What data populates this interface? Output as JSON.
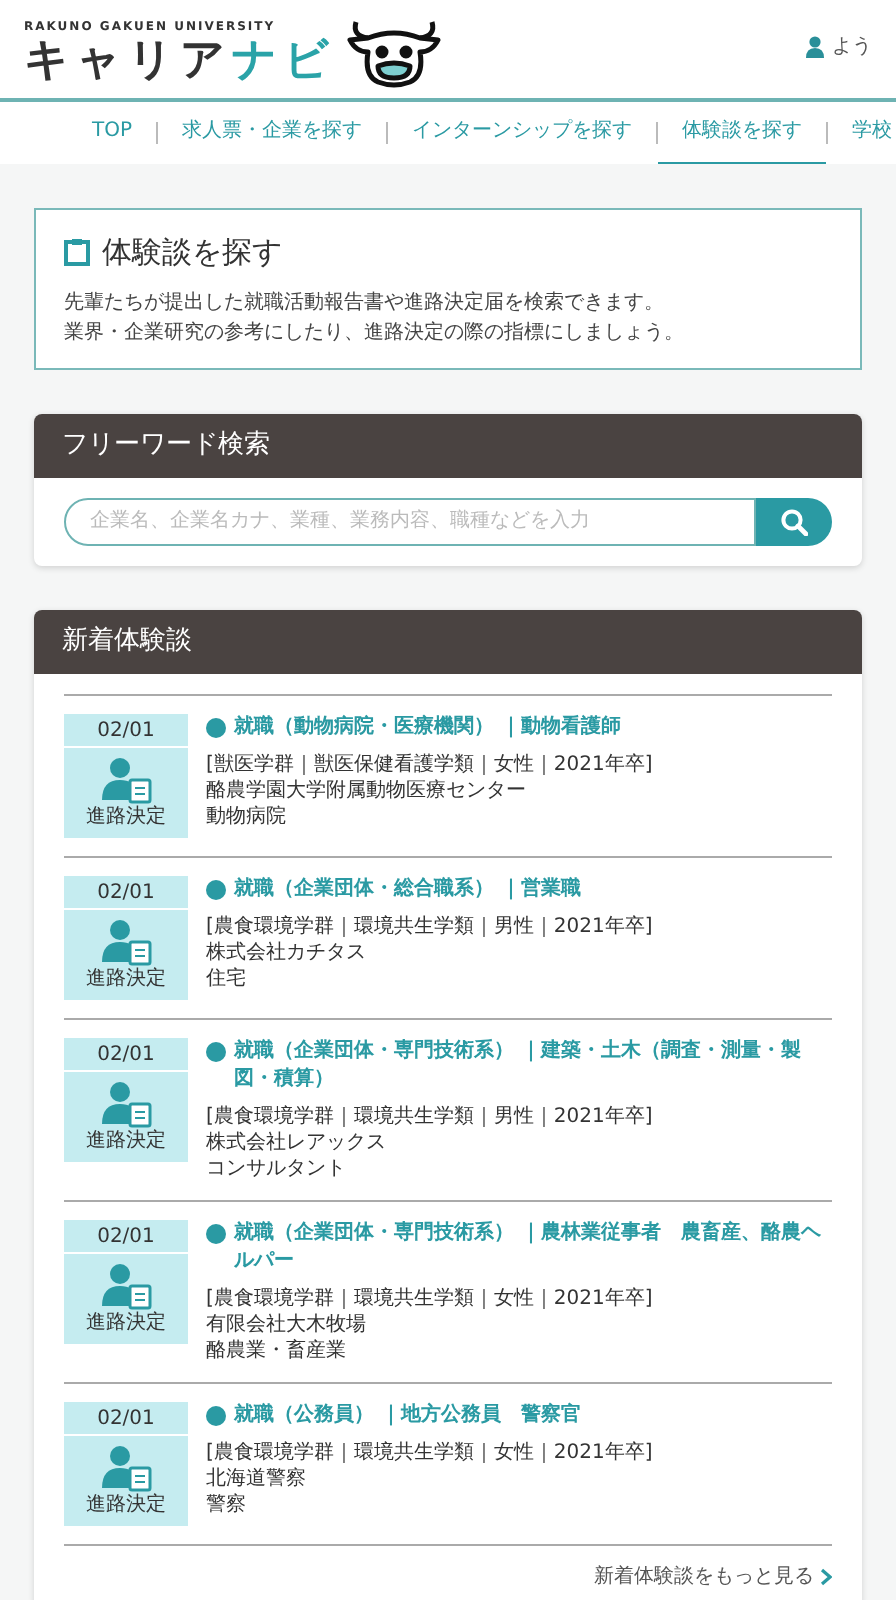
{
  "header": {
    "tagline": "RAKUNO GAKUEN UNIVERSITY",
    "logo_main": "キャリア",
    "logo_accent": "ナビ",
    "user_text": "よう"
  },
  "nav": [
    {
      "label": "TOP",
      "selected": false
    },
    {
      "label": "求人票・企業を探す",
      "selected": false
    },
    {
      "label": "インターンシップを探す",
      "selected": false
    },
    {
      "label": "体験談を探す",
      "selected": true
    },
    {
      "label": "学校",
      "selected": false
    }
  ],
  "intro": {
    "title": "体験談を探す",
    "lines": [
      "先輩たちが提出した就職活動報告書や進路決定届を検索できます。",
      "業界・企業研究の参考にしたり、進路決定の際の指標にしましょう。"
    ]
  },
  "search": {
    "title": "フリーワード検索",
    "placeholder": "企業名、企業名カナ、業種、業務内容、職種などを入力"
  },
  "news": {
    "title": "新着体験談",
    "more_link": "新着体験談をもっと見る",
    "entries": [
      {
        "date": "02/01",
        "status": "進路決定",
        "title": "就職（動物病院・医療機関） ｜動物看護師",
        "profile": "[獣医学群｜獣医保健看護学類｜女性｜2021年卒]",
        "company": "酪農学園大学附属動物医療センター",
        "industry": "動物病院"
      },
      {
        "date": "02/01",
        "status": "進路決定",
        "title": "就職（企業団体・総合職系） ｜営業職",
        "profile": "[農食環境学群｜環境共生学類｜男性｜2021年卒]",
        "company": "株式会社カチタス",
        "industry": "住宅"
      },
      {
        "date": "02/01",
        "status": "進路決定",
        "title": "就職（企業団体・専門技術系） ｜建築・土木（調査・測量・製図・積算）",
        "profile": "[農食環境学群｜環境共生学類｜男性｜2021年卒]",
        "company": "株式会社レアックス",
        "industry": "コンサルタント"
      },
      {
        "date": "02/01",
        "status": "進路決定",
        "title": "就職（企業団体・専門技術系） ｜農林業従事者　農畜産、酪農ヘルパー",
        "profile": "[農食環境学群｜環境共生学類｜女性｜2021年卒]",
        "company": "有限会社大木牧場",
        "industry": "酪農業・畜産業"
      },
      {
        "date": "02/01",
        "status": "進路決定",
        "title": "就職（公務員） ｜地方公務員　警察官",
        "profile": "[農食環境学群｜環境共生学類｜女性｜2021年卒]",
        "company": "北海道警察",
        "industry": "警察"
      }
    ]
  }
}
